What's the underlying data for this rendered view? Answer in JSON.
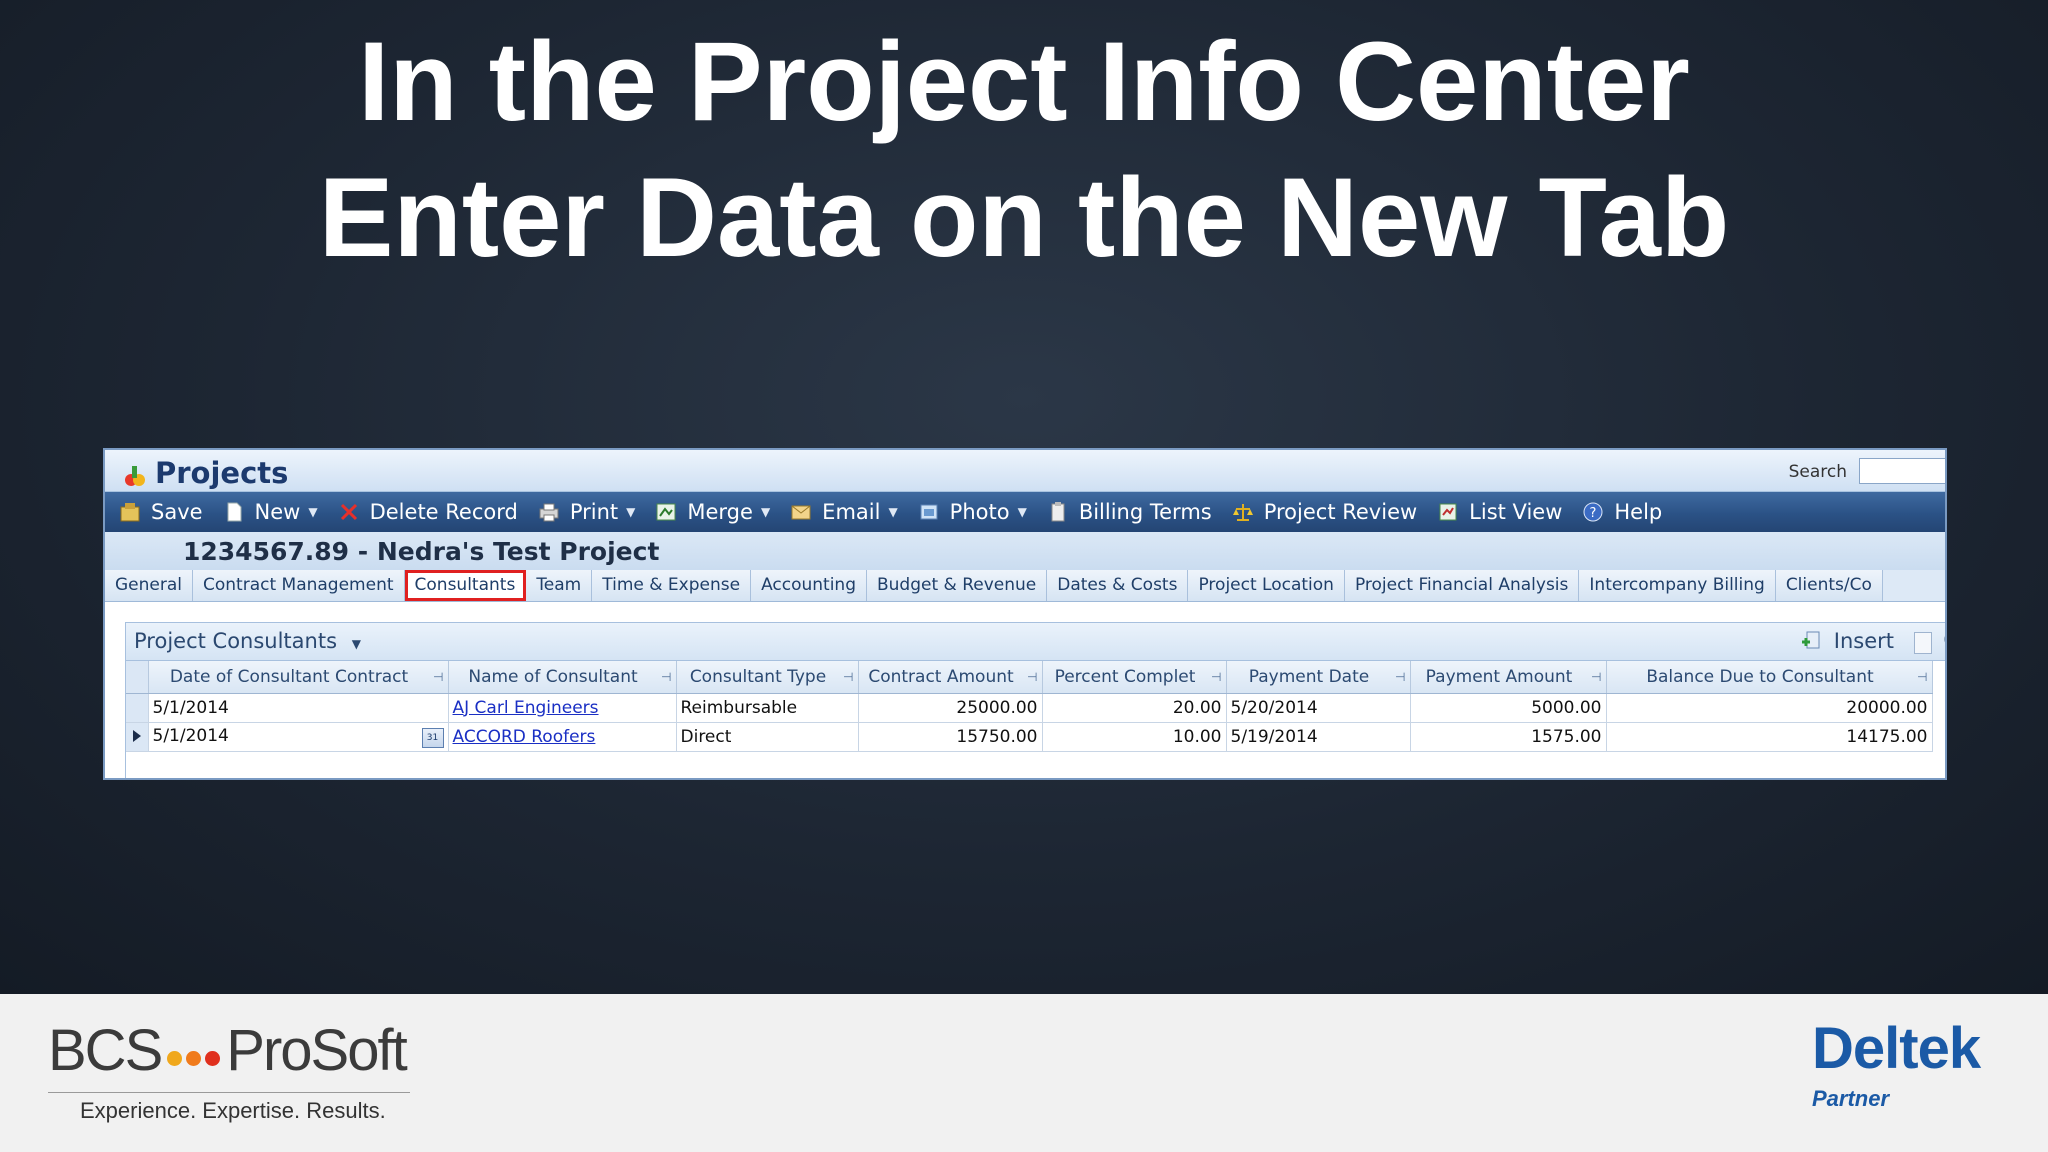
{
  "slide": {
    "title_line1": "In the Project Info Center",
    "title_line2": "Enter Data on the New Tab"
  },
  "footer": {
    "bcs_left": "BCS",
    "bcs_right": "ProSoft",
    "bcs_tagline": "Experience. Expertise. Results.",
    "deltek_name": "Deltek",
    "deltek_partner": "Partner",
    "dot_colors": [
      "#f0a81c",
      "#f07b1c",
      "#e0301e"
    ]
  },
  "app": {
    "title": "Projects",
    "search_label": "Search",
    "search_value": "",
    "toolbar": {
      "save": "Save",
      "new": "New",
      "delete": "Delete Record",
      "print": "Print",
      "merge": "Merge",
      "email": "Email",
      "photo": "Photo",
      "billing_terms": "Billing Terms",
      "project_review": "Project Review",
      "list_view": "List View",
      "help": "Help"
    },
    "project_name": "1234567.89 - Nedra's Test Project",
    "tabs": [
      "General",
      "Contract Management",
      "Consultants",
      "Team",
      "Time & Expense",
      "Accounting",
      "Budget & Revenue",
      "Dates & Costs",
      "Project Location",
      "Project Financial Analysis",
      "Intercompany Billing",
      "Clients/Co"
    ],
    "active_tab": "Consultants",
    "section": {
      "title": "Project Consultants",
      "insert_label": "Insert",
      "more_label": "C",
      "columns": [
        "Date of Consultant Contract",
        "Name of Consultant",
        "Consultant Type",
        "Contract Amount",
        "Percent Complet",
        "Payment Date",
        "Payment Amount",
        "Balance Due to Consultant"
      ],
      "rows": [
        [
          "5/1/2014",
          "AJ Carl Engineers",
          "Reimbursable",
          "25000.00",
          "20.00",
          "5/20/2014",
          "5000.00",
          "20000.00"
        ],
        [
          "5/1/2014",
          "ACCORD Roofers",
          "Direct",
          "15750.00",
          "10.00",
          "5/19/2014",
          "1575.00",
          "14175.00"
        ]
      ],
      "calendar_icon_text": "31"
    }
  }
}
